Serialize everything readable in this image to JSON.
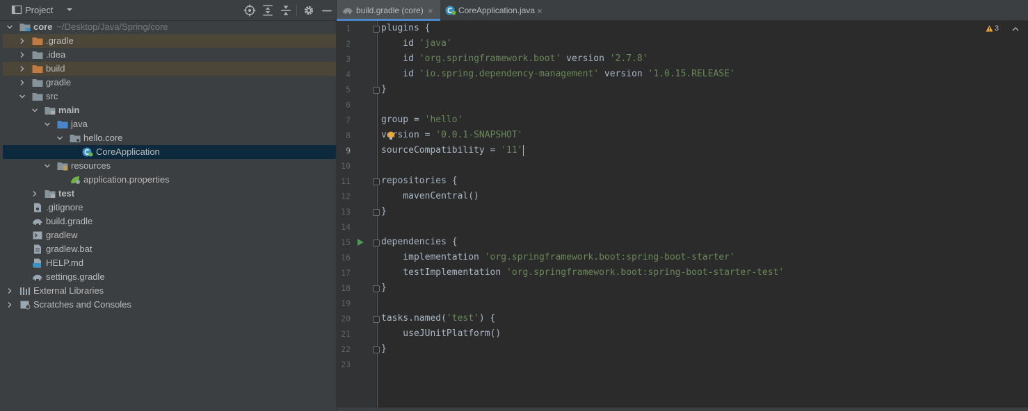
{
  "project_panel": {
    "title": "Project",
    "tree": [
      {
        "label": "core",
        "path": "~/Desktop/Java/Spring/core",
        "depth": 0,
        "expanded": true,
        "icon": "module-folder-icon",
        "bold": true
      },
      {
        "label": ".gradle",
        "depth": 1,
        "expanded": false,
        "icon": "excluded-folder-icon",
        "excluded": true
      },
      {
        "label": ".idea",
        "depth": 1,
        "expanded": false,
        "icon": "folder-icon"
      },
      {
        "label": "build",
        "depth": 1,
        "expanded": false,
        "icon": "excluded-folder-icon",
        "excluded": true
      },
      {
        "label": "gradle",
        "depth": 1,
        "expanded": false,
        "icon": "folder-icon"
      },
      {
        "label": "src",
        "depth": 1,
        "expanded": true,
        "icon": "folder-icon"
      },
      {
        "label": "main",
        "depth": 2,
        "expanded": true,
        "icon": "source-set-folder-icon",
        "bold": true
      },
      {
        "label": "java",
        "depth": 3,
        "expanded": true,
        "icon": "source-root-folder-icon"
      },
      {
        "label": "hello.core",
        "depth": 4,
        "expanded": true,
        "icon": "package-icon"
      },
      {
        "label": "CoreApplication",
        "depth": 5,
        "icon": "spring-class-icon",
        "selected": true
      },
      {
        "label": "resources",
        "depth": 3,
        "expanded": true,
        "icon": "resources-folder-icon"
      },
      {
        "label": "application.properties",
        "depth": 4,
        "icon": "spring-properties-icon"
      },
      {
        "label": "test",
        "depth": 2,
        "expanded": false,
        "icon": "source-set-folder-icon",
        "bold": true
      },
      {
        "label": ".gitignore",
        "depth": 1,
        "icon": "gitignore-file-icon"
      },
      {
        "label": "build.gradle",
        "depth": 1,
        "icon": "gradle-file-icon"
      },
      {
        "label": "gradlew",
        "depth": 1,
        "icon": "script-file-icon"
      },
      {
        "label": "gradlew.bat",
        "depth": 1,
        "icon": "bat-file-icon"
      },
      {
        "label": "HELP.md",
        "depth": 1,
        "icon": "markdown-file-icon"
      },
      {
        "label": "settings.gradle",
        "depth": 1,
        "icon": "gradle-file-icon"
      },
      {
        "label": "External Libraries",
        "depth": 0,
        "expanded": false,
        "icon": "libraries-icon"
      },
      {
        "label": "Scratches and Consoles",
        "depth": 0,
        "expanded": false,
        "icon": "scratches-icon"
      }
    ]
  },
  "tabs": [
    {
      "label": "build.gradle (core)",
      "icon": "gradle-file-icon",
      "active": true
    },
    {
      "label": "CoreApplication.java",
      "icon": "spring-class-icon",
      "active": false
    }
  ],
  "editor": {
    "warnings_count": "3",
    "current_line": 9,
    "lines": [
      [
        {
          "t": "plugins {"
        }
      ],
      [
        {
          "t": "    id "
        },
        {
          "t": "'java'",
          "c": "str"
        }
      ],
      [
        {
          "t": "    id "
        },
        {
          "t": "'org.springframework.boot'",
          "c": "str"
        },
        {
          "t": " version "
        },
        {
          "t": "'2.7.8'",
          "c": "str"
        }
      ],
      [
        {
          "t": "    id "
        },
        {
          "t": "'io.spring.dependency-management'",
          "c": "str"
        },
        {
          "t": " version "
        },
        {
          "t": "'1.0.15.RELEASE'",
          "c": "str"
        }
      ],
      [
        {
          "t": "}"
        }
      ],
      [],
      [
        {
          "t": "group = "
        },
        {
          "t": "'hello'",
          "c": "str"
        }
      ],
      [
        {
          "t": "version = "
        },
        {
          "t": "'0.0.1-SNAPSHOT'",
          "c": "str"
        }
      ],
      [
        {
          "t": "sourceCompatibility = "
        },
        {
          "t": "'11'",
          "c": "str"
        }
      ],
      [],
      [
        {
          "t": "repositories {"
        }
      ],
      [
        {
          "t": "    mavenCentral()"
        }
      ],
      [
        {
          "t": "}"
        }
      ],
      [],
      [
        {
          "t": "dependencies {"
        }
      ],
      [
        {
          "t": "    implementation "
        },
        {
          "t": "'org.springframework.boot:spring-boot-starter'",
          "c": "str"
        }
      ],
      [
        {
          "t": "    testImplementation "
        },
        {
          "t": "'org.springframework.boot:spring-boot-starter-test'",
          "c": "str"
        }
      ],
      [
        {
          "t": "}"
        }
      ],
      [],
      [
        {
          "t": "tasks.named("
        },
        {
          "t": "'test'",
          "c": "str"
        },
        {
          "t": ") {"
        }
      ],
      [
        {
          "t": "    useJUnitPlatform()"
        }
      ],
      [
        {
          "t": "}"
        }
      ],
      []
    ],
    "line_numbers": [
      "1",
      "2",
      "3",
      "4",
      "5",
      "6",
      "7",
      "8",
      "9",
      "10",
      "11",
      "12",
      "13",
      "14",
      "15",
      "16",
      "17",
      "18",
      "19",
      "20",
      "21",
      "22",
      "23"
    ]
  },
  "colors": {
    "accent": "#4a88c7",
    "selection": "#0d293e",
    "excluded": "#4c4639",
    "string": "#6a8759",
    "run_green": "#499c54",
    "warning": "#f0a732"
  }
}
